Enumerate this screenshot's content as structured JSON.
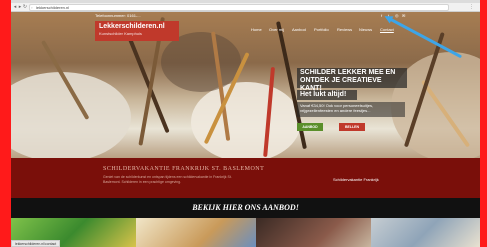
{
  "browser": {
    "url": "lekkerschilderen.nl",
    "back_icon": "arrow-left-icon",
    "forward_icon": "arrow-right-icon",
    "reload_icon": "reload-icon",
    "menu_icon": "menu-dots-icon"
  },
  "site": {
    "phone_text": "Telefoonnummer: 0161-...",
    "social_icons": [
      "facebook-icon",
      "twitter-icon",
      "instagram-icon",
      "email-icon"
    ],
    "logo_title": "Lekkerschilderen.nl",
    "logo_subtitle": "Kunstschilder Kamphuis",
    "nav": [
      "Home",
      "Over mij",
      "Aanbod",
      "Portfolio",
      "Reviews",
      "Nieuws",
      "Contact"
    ],
    "nav_active": "Contact",
    "hero": {
      "line1": "SCHILDER LEKKER MEE EN",
      "line2": "ONTDEK JE CREATIEVE KANT!",
      "line3": "Het lukt altijd!",
      "subtext": "Vanaf €34,50! Ook voor personeelsuitjes, vrijgezellenfeesten en andere feestjes...",
      "btn_left": "AANBOD",
      "btn_right": "BELLEN"
    },
    "band": {
      "title": "SCHILDERVAKANTIE FRANKRIJK ST. BASLEMONT",
      "description": "Geniet van de schilderkunst en ontspan tijdens een schildervakantie in Frankrijk St. Baslemont. Schilderen in een prachtige omgeving.",
      "link": "Schildervakantie Frankrijk"
    },
    "offer_heading": "BEKIJK HIER ONS AANBOD!",
    "status_text": "lekkerschilderen.nl/contact"
  },
  "colors": {
    "frame": "#ff1a1a",
    "brand_red": "#c0392b",
    "band_red": "#7a0f0a",
    "arrow_blue": "#3da5e8",
    "button_green": "#5a8f2b"
  }
}
